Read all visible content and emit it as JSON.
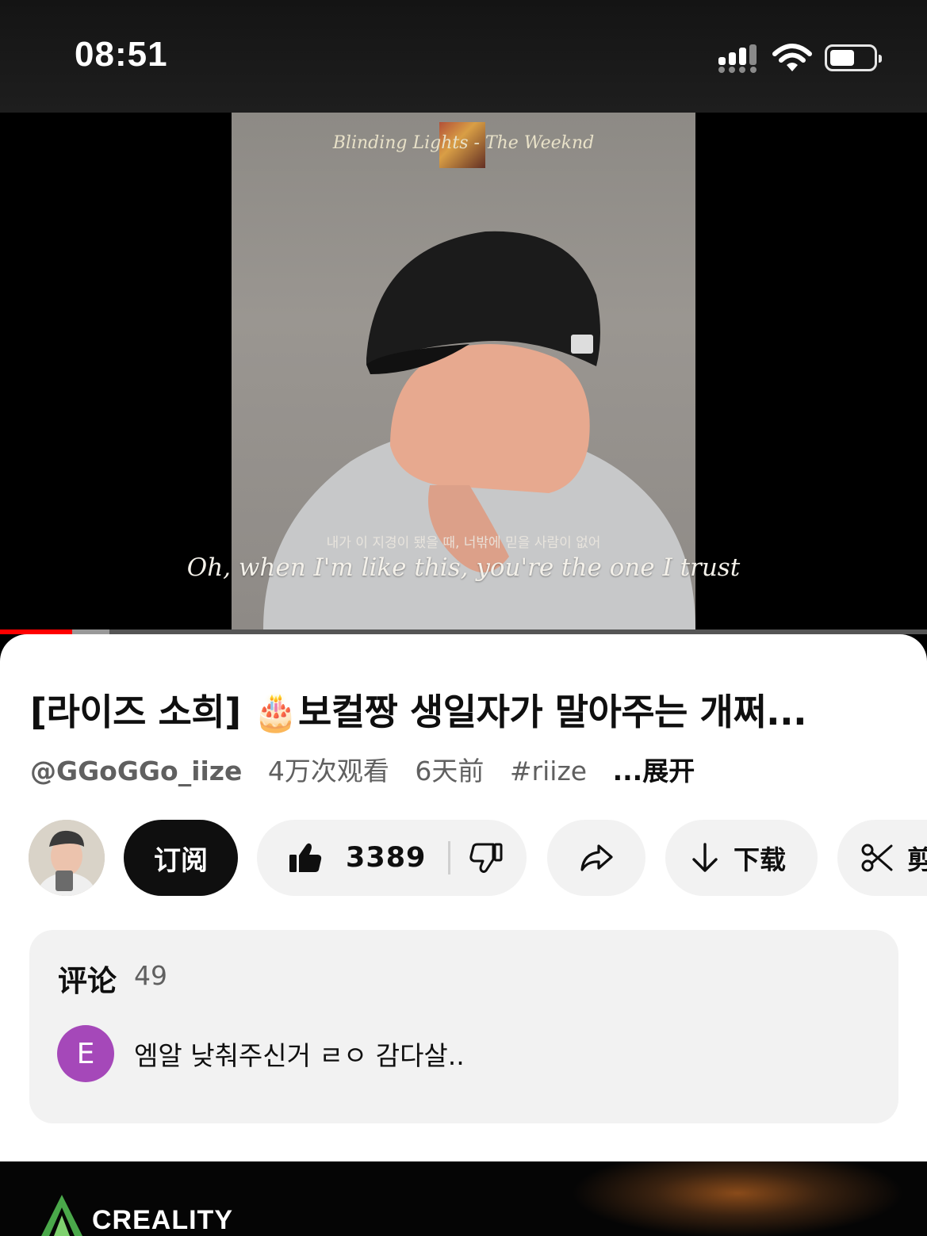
{
  "status_bar": {
    "time": "08:51",
    "battery_level": 0.5
  },
  "video": {
    "song_title": "Blinding Lights - The Weeknd",
    "subtitle_korean": "내가 이 지경이 됐을 때, 너밖에 믿을 사람이 없어",
    "subtitle_english": "Oh, when I'm like this, you're the one I trust",
    "progress_played": 0.078,
    "progress_buffered": 0.118
  },
  "video_info": {
    "title": "[라이즈 소희] 🎂보컬짱 생일자가 말아주는 개쩌...",
    "channel": "@GGoGGo_iize",
    "views": "4万次观看",
    "age": "6天前",
    "hashtag": "#riize",
    "expand_label": "...展开"
  },
  "actions": {
    "subscribe_label": "订阅",
    "like_count": "3389",
    "download_label": "下载",
    "clip_label": "剪"
  },
  "comments": {
    "header": "评论",
    "count": "49",
    "top_comment_avatar_letter": "E",
    "top_comment_text": "엠알 낮춰주신거 ㄹㅇ 감다살.."
  },
  "ad": {
    "brand": "CREALITY"
  },
  "colors": {
    "accent_red": "#ff0000",
    "subscribe_bg": "#0f0f0f",
    "comment_avatar": "#a548b9"
  }
}
